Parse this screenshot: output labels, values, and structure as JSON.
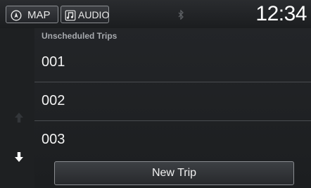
{
  "status": {
    "map_label": "MAP",
    "audio_label": "AUDIO",
    "clock": "12:34",
    "icons": [
      "navigation-compass-icon",
      "music-note-icon",
      "bluetooth-icon"
    ]
  },
  "list": {
    "header": "Unscheduled Trips",
    "items": [
      {
        "label": "001"
      },
      {
        "label": "002"
      },
      {
        "label": "003"
      }
    ],
    "new_trip_label": "New Trip"
  },
  "scroll": {
    "up_enabled": false,
    "down_enabled": true
  },
  "colors": {
    "background": "#1a1c1e",
    "text": "#f2f2f2",
    "header_text": "#a7aaae",
    "divider": "#4a4d51"
  }
}
